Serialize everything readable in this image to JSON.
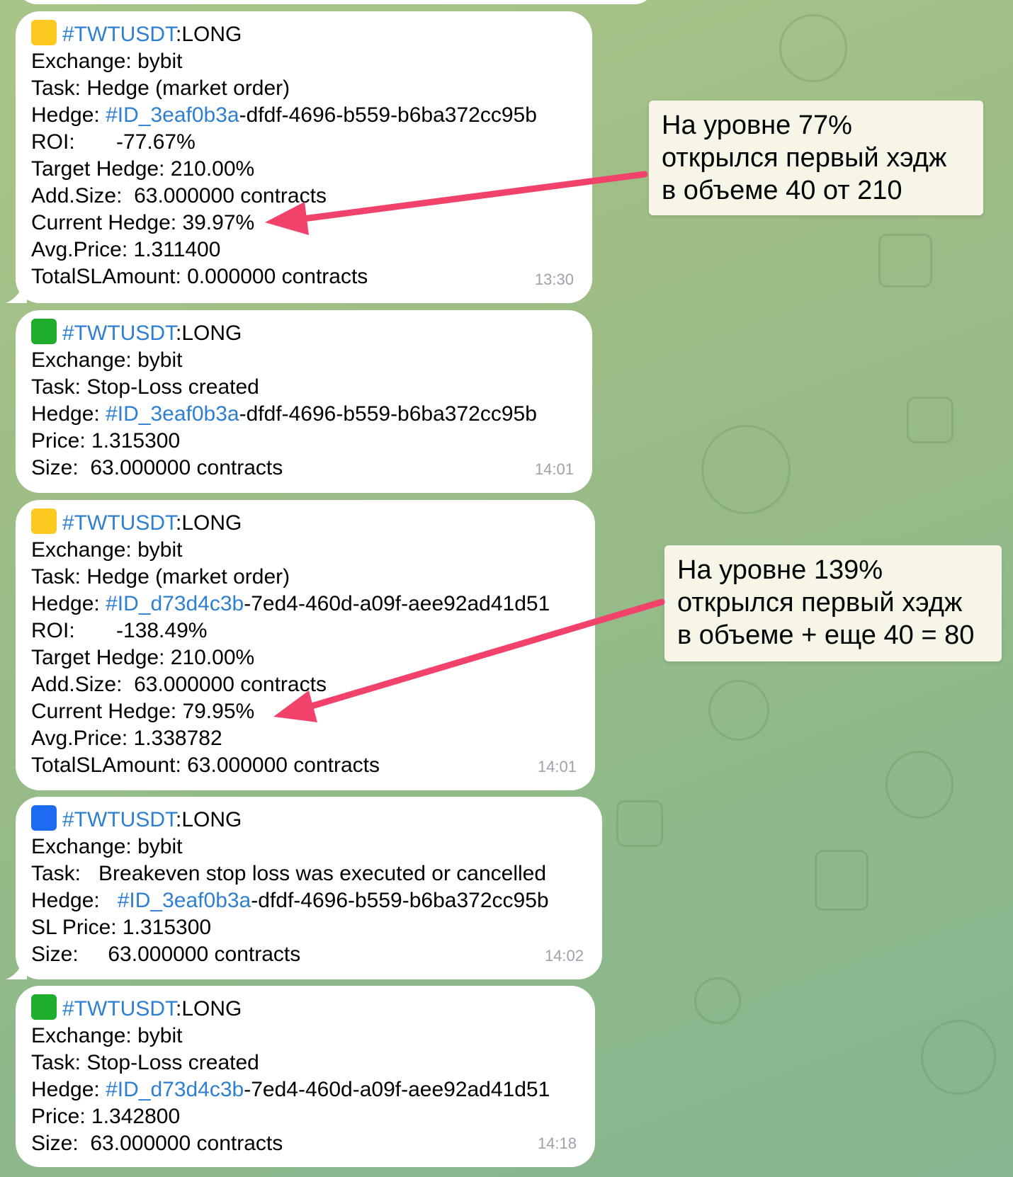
{
  "colors": {
    "yellow": "#fcc921",
    "green": "#1fae2c",
    "blue": "#1c6bf0",
    "link": "#2f7fd1",
    "arrow": "#f0426a"
  },
  "messages": [
    {
      "icon": "yellow-square-icon",
      "hashtag": "#TWTUSDT",
      "side": ":LONG",
      "lines": [
        "Exchange: bybit",
        "Task: Hedge (market order)"
      ],
      "hedge_label": "Hedge: ",
      "hedge_id": "#ID_3eaf0b3a",
      "hedge_rest": "-dfdf-4696-b559-b6ba372cc95b",
      "lines2": [
        "ROI:       -77.67%",
        "Target Hedge: 210.00%",
        "Add.Size:  63.000000 contracts",
        "Current Hedge: 39.97%",
        "Avg.Price: 1.311400",
        "TotalSLAmount: 0.000000 contracts"
      ],
      "time": "13:30"
    },
    {
      "icon": "green-square-icon",
      "hashtag": "#TWTUSDT",
      "side": ":LONG",
      "lines": [
        "Exchange: bybit",
        "Task: Stop-Loss created"
      ],
      "hedge_label": "Hedge: ",
      "hedge_id": "#ID_3eaf0b3a",
      "hedge_rest": "-dfdf-4696-b559-b6ba372cc95b",
      "lines2": [
        "Price: 1.315300",
        "Size:  63.000000 contracts"
      ],
      "time": "14:01"
    },
    {
      "icon": "yellow-square-icon",
      "hashtag": "#TWTUSDT",
      "side": ":LONG",
      "lines": [
        "Exchange: bybit",
        "Task: Hedge (market order)"
      ],
      "hedge_label": "Hedge: ",
      "hedge_id": "#ID_d73d4c3b",
      "hedge_rest": "-7ed4-460d-a09f-aee92ad41d51",
      "lines2": [
        "ROI:       -138.49%",
        "Target Hedge: 210.00%",
        "Add.Size:  63.000000 contracts",
        "Current Hedge: 79.95%",
        "Avg.Price: 1.338782",
        "TotalSLAmount: 63.000000 contracts"
      ],
      "time": "14:01"
    },
    {
      "icon": "blue-square-icon",
      "hashtag": "#TWTUSDT",
      "side": ":LONG",
      "lines": [
        "Exchange: bybit",
        "Task:   Breakeven stop loss was executed or cancelled"
      ],
      "hedge_label": "Hedge:   ",
      "hedge_id": "#ID_3eaf0b3a",
      "hedge_rest": "-dfdf-4696-b559-b6ba372cc95b",
      "lines2": [
        "SL Price: 1.315300",
        "Size:     63.000000 contracts"
      ],
      "time": "14:02"
    },
    {
      "icon": "green-square-icon",
      "hashtag": "#TWTUSDT",
      "side": ":LONG",
      "lines": [
        "Exchange: bybit",
        "Task: Stop-Loss created"
      ],
      "hedge_label": "Hedge: ",
      "hedge_id": "#ID_d73d4c3b",
      "hedge_rest": "-7ed4-460d-a09f-aee92ad41d51",
      "lines2": [
        "Price: 1.342800",
        "Size:  63.000000 contracts"
      ],
      "time": "14:18"
    }
  ],
  "annotations": [
    {
      "lines": [
        "На уровне 77%",
        "открылся первый хэдж",
        "в объеме 40 от 210"
      ]
    },
    {
      "lines": [
        "На уровне 139%",
        "открылся первый хэдж",
        "в объеме + еще 40 = 80"
      ]
    }
  ]
}
